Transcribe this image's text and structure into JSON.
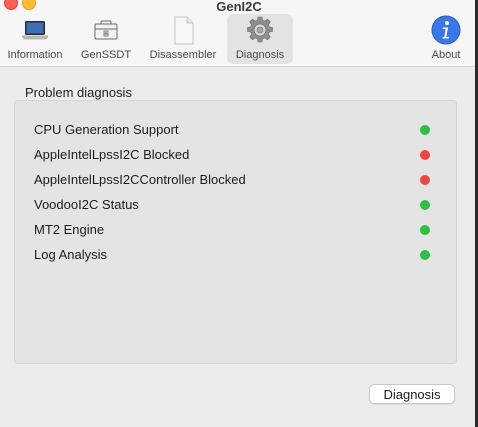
{
  "window": {
    "title": "GenI2C"
  },
  "toolbar": {
    "items": [
      {
        "label": "Information",
        "icon": "laptop-icon"
      },
      {
        "label": "GenSSDT",
        "icon": "toolbox-icon"
      },
      {
        "label": "Disassembler",
        "icon": "document-icon"
      },
      {
        "label": "Diagnosis",
        "icon": "gear-icon",
        "selected": true
      },
      {
        "label": "About",
        "icon": "info-icon"
      }
    ]
  },
  "main": {
    "section_title": "Problem diagnosis",
    "checks": [
      {
        "label": "CPU Generation Support",
        "status": "ok",
        "color": "#2ebd45"
      },
      {
        "label": "AppleIntelLpssI2C Blocked",
        "status": "error",
        "color": "#ed4545"
      },
      {
        "label": "AppleIntelLpssI2CController Blocked",
        "status": "error",
        "color": "#ed4545"
      },
      {
        "label": "VoodooI2C Status",
        "status": "ok",
        "color": "#2ebd45"
      },
      {
        "label": "MT2 Engine",
        "status": "ok",
        "color": "#2ebd45"
      },
      {
        "label": "Log Analysis",
        "status": "ok",
        "color": "#2ebd45"
      }
    ],
    "diagnosis_button_label": "Diagnosis"
  },
  "colors": {
    "ok": "#2ebd45",
    "error": "#ed4545",
    "info_blue": "#3b78e7"
  }
}
